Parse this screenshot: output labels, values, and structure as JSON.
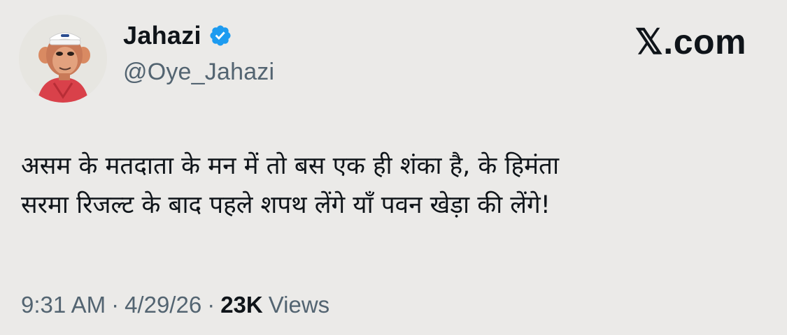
{
  "post": {
    "author": {
      "display_name": "Jahazi",
      "handle": "@Oye_Jahazi",
      "verified_icon": "verified-badge-icon",
      "avatar_icon": "ape-avatar"
    },
    "brand": {
      "label": "𝕏.com"
    },
    "text_lines": [
      "असम के मतदाता के मन में तो बस एक ही शंका है, के हिमंता",
      "सरमा रिजल्ट के बाद पहले शपथ लेंगे याँ पवन खेड़ा की लेंगे!"
    ],
    "meta": {
      "time": "9:31 AM",
      "separator": "·",
      "date": "4/29/26",
      "views_count": "23K",
      "views_label": "Views"
    }
  },
  "colors": {
    "background": "#ebeae8",
    "text": "#0f1419",
    "muted": "#536471",
    "verified": "#1d9bf0"
  }
}
